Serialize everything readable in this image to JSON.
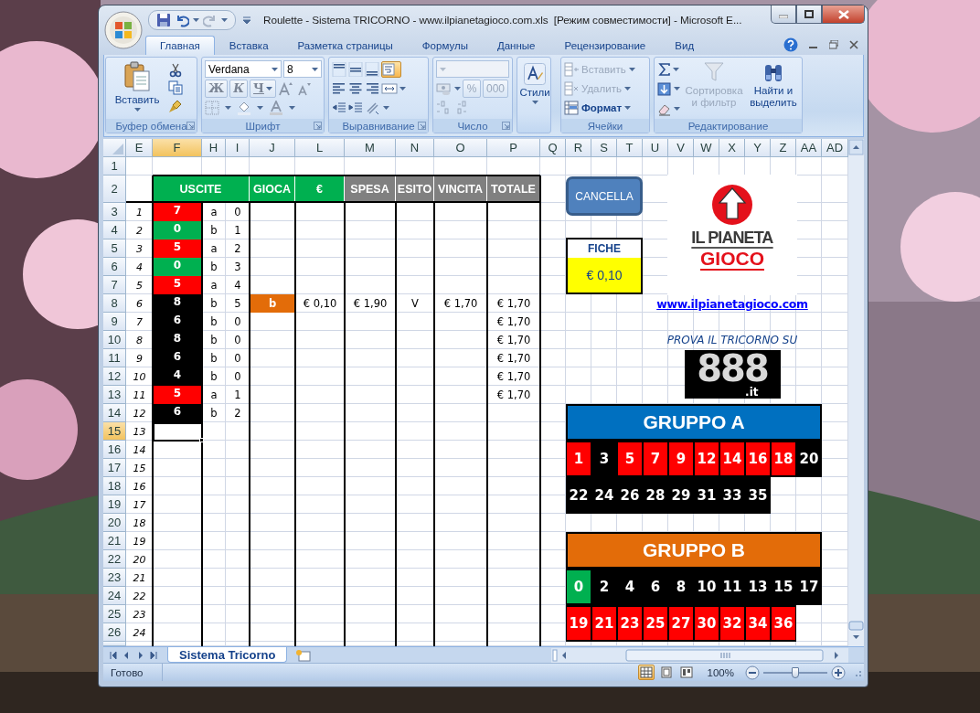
{
  "window": {
    "title": "Roulette - Sistema TRICORNO - www.ilpianetagioco.com.xls  [Режим совместимости] - Microsoft E..."
  },
  "ribbon_tabs": [
    {
      "label": "Главная",
      "selected": true
    },
    {
      "label": "Вставка",
      "selected": false
    },
    {
      "label": "Разметка страницы",
      "selected": false
    },
    {
      "label": "Формулы",
      "selected": false
    },
    {
      "label": "Данные",
      "selected": false
    },
    {
      "label": "Рецензирование",
      "selected": false
    },
    {
      "label": "Вид",
      "selected": false
    }
  ],
  "clipboard": {
    "label": "Буфер обмена",
    "paste": "Вставить"
  },
  "font": {
    "label": "Шрифт",
    "name": "Verdana",
    "size": "8",
    "styles": [
      "Ж",
      "К",
      "Ч"
    ]
  },
  "alignment": {
    "label": "Выравнивание",
    "wrap_text": {
      "on": true
    }
  },
  "number": {
    "label": "Число",
    "buttons": [
      "%",
      "000"
    ]
  },
  "styles": {
    "label": "Стили"
  },
  "cells": {
    "label": "Ячейки",
    "items": [
      {
        "label": "Вставить",
        "disabled": true
      },
      {
        "label": "Удалить",
        "disabled": true
      },
      {
        "label": "Формат",
        "disabled": false
      }
    ]
  },
  "editing": {
    "label": "Редактирование",
    "items": [
      {
        "label": "Сортировка и фильтр",
        "disabled": true
      },
      {
        "label": "Найти и выделить",
        "disabled": false
      }
    ]
  },
  "columns": [
    {
      "label": "E",
      "selected": false
    },
    {
      "label": "F",
      "selected": true
    },
    {
      "label": "H",
      "selected": false
    },
    {
      "label": "I",
      "selected": false
    },
    {
      "label": "J",
      "selected": false
    },
    {
      "label": "L",
      "selected": false
    },
    {
      "label": "M",
      "selected": false
    },
    {
      "label": "N",
      "selected": false
    },
    {
      "label": "O",
      "selected": false
    },
    {
      "label": "P",
      "selected": false
    },
    {
      "label": "Q",
      "selected": false
    },
    {
      "label": "R",
      "selected": false
    },
    {
      "label": "S",
      "selected": false
    },
    {
      "label": "T",
      "selected": false
    },
    {
      "label": "U",
      "selected": false
    },
    {
      "label": "V",
      "selected": false
    },
    {
      "label": "W",
      "selected": false
    },
    {
      "label": "X",
      "selected": false
    },
    {
      "label": "Y",
      "selected": false
    },
    {
      "label": "Z",
      "selected": false
    },
    {
      "label": "AA",
      "selected": false
    },
    {
      "label": "AD",
      "selected": false
    }
  ],
  "row_numbers": [
    {
      "label": "1",
      "selected": false
    },
    {
      "label": "2",
      "selected": false
    },
    {
      "label": "3",
      "selected": false
    },
    {
      "label": "4",
      "selected": false
    },
    {
      "label": "5",
      "selected": false
    },
    {
      "label": "6",
      "selected": false
    },
    {
      "label": "7",
      "selected": false
    },
    {
      "label": "8",
      "selected": false
    },
    {
      "label": "9",
      "selected": false
    },
    {
      "label": "10",
      "selected": false
    },
    {
      "label": "11",
      "selected": false
    },
    {
      "label": "12",
      "selected": false
    },
    {
      "label": "13",
      "selected": false
    },
    {
      "label": "14",
      "selected": false
    },
    {
      "label": "15",
      "selected": true
    },
    {
      "label": "16",
      "selected": false
    },
    {
      "label": "17",
      "selected": false
    },
    {
      "label": "18",
      "selected": false
    },
    {
      "label": "19",
      "selected": false
    },
    {
      "label": "20",
      "selected": false
    },
    {
      "label": "21",
      "selected": false
    },
    {
      "label": "22",
      "selected": false
    },
    {
      "label": "23",
      "selected": false
    },
    {
      "label": "24",
      "selected": false
    },
    {
      "label": "25",
      "selected": false
    },
    {
      "label": "26",
      "selected": false
    }
  ],
  "headers": [
    {
      "label": "USCITE",
      "color": "#00b050"
    },
    {
      "label": "GIOCA",
      "color": "#00b050"
    },
    {
      "label": "€",
      "color": "#00b050"
    },
    {
      "label": "SPESA",
      "color": "#808080"
    },
    {
      "label": "ESITO",
      "color": "#808080"
    },
    {
      "label": "VINCITA",
      "color": "#808080"
    },
    {
      "label": "TOTALE",
      "color": "#808080"
    }
  ],
  "rows": [
    {
      "index": "1",
      "number": "7",
      "color": "#ff0000",
      "letter": "a",
      "count": "0",
      "selected": false
    },
    {
      "index": "2",
      "number": "0",
      "color": "#00b050",
      "letter": "b",
      "count": "1",
      "selected": false
    },
    {
      "index": "3",
      "number": "5",
      "color": "#ff0000",
      "letter": "a",
      "count": "2",
      "selected": false
    },
    {
      "index": "4",
      "number": "0",
      "color": "#00b050",
      "letter": "b",
      "count": "3",
      "selected": false
    },
    {
      "index": "5",
      "number": "5",
      "color": "#ff0000",
      "letter": "a",
      "count": "4",
      "selected": false
    },
    {
      "index": "6",
      "number": "8",
      "color": "#000000",
      "letter": "b",
      "count": "5",
      "gioca": "b",
      "bet": "€ 0,10",
      "spesa": "€ 1,90",
      "esito": "V",
      "vincita": "€ 1,70",
      "totale": "€ 1,70",
      "selected": false
    },
    {
      "index": "7",
      "number": "6",
      "color": "#000000",
      "letter": "b",
      "count": "0",
      "totale": "€ 1,70",
      "selected": false
    },
    {
      "index": "8",
      "number": "8",
      "color": "#000000",
      "letter": "b",
      "count": "0",
      "totale": "€ 1,70",
      "selected": false
    },
    {
      "index": "9",
      "number": "6",
      "color": "#000000",
      "letter": "b",
      "count": "0",
      "totale": "€ 1,70",
      "selected": false
    },
    {
      "index": "10",
      "number": "4",
      "color": "#000000",
      "letter": "b",
      "count": "0",
      "totale": "€ 1,70",
      "selected": false
    },
    {
      "index": "11",
      "number": "5",
      "color": "#ff0000",
      "letter": "a",
      "count": "1",
      "totale": "€ 1,70",
      "selected": false
    },
    {
      "index": "12",
      "number": "6",
      "color": "#000000",
      "letter": "b",
      "count": "2",
      "selected": false
    },
    {
      "index": "13",
      "selected": true
    },
    {
      "index": "14",
      "selected": false
    },
    {
      "index": "15",
      "selected": false
    },
    {
      "index": "16",
      "selected": false
    },
    {
      "index": "17",
      "selected": false
    },
    {
      "index": "18",
      "selected": false
    },
    {
      "index": "19",
      "selected": false
    },
    {
      "index": "20",
      "selected": false
    },
    {
      "index": "21",
      "selected": false
    },
    {
      "index": "22",
      "selected": false
    },
    {
      "index": "23",
      "selected": false
    },
    {
      "index": "24",
      "selected": false
    }
  ],
  "cancel_button": "CANCELLA",
  "fiche": {
    "label": "FICHE",
    "value": "€ 0,10"
  },
  "logo": {
    "lines": [
      "IL PIANETA",
      "GIOCO"
    ]
  },
  "link": "www.ilpianetagioco.com",
  "promo": {
    "text": "PROVA IL TRICORNO SU",
    "logo": "888",
    "suffix": ".it"
  },
  "groups": [
    {
      "title": "GRUPPO A",
      "color": "#0070c0",
      "rows": [
        {
          "cells": [
            {
              "label": "1",
              "color": "#ff0000"
            },
            {
              "label": "3",
              "color": "#000000"
            },
            {
              "label": "5",
              "color": "#ff0000"
            },
            {
              "label": "7",
              "color": "#ff0000"
            },
            {
              "label": "9",
              "color": "#ff0000"
            },
            {
              "label": "12",
              "color": "#ff0000"
            },
            {
              "label": "14",
              "color": "#ff0000"
            },
            {
              "label": "16",
              "color": "#ff0000"
            },
            {
              "label": "18",
              "color": "#ff0000"
            },
            {
              "label": "20",
              "color": "#000000"
            }
          ]
        },
        {
          "cells": [
            {
              "label": "22",
              "color": "#000000"
            },
            {
              "label": "24",
              "color": "#000000"
            },
            {
              "label": "26",
              "color": "#000000"
            },
            {
              "label": "28",
              "color": "#000000"
            },
            {
              "label": "29",
              "color": "#000000"
            },
            {
              "label": "31",
              "color": "#000000"
            },
            {
              "label": "33",
              "color": "#000000"
            },
            {
              "label": "35",
              "color": "#000000"
            }
          ]
        }
      ]
    },
    {
      "title": "GRUPPO B",
      "color": "#e36c09",
      "rows": [
        {
          "cells": [
            {
              "label": "0",
              "color": "#00b050"
            },
            {
              "label": "2",
              "color": "#000000"
            },
            {
              "label": "4",
              "color": "#000000"
            },
            {
              "label": "6",
              "color": "#000000"
            },
            {
              "label": "8",
              "color": "#000000"
            },
            {
              "label": "10",
              "color": "#000000"
            },
            {
              "label": "11",
              "color": "#000000"
            },
            {
              "label": "13",
              "color": "#000000"
            },
            {
              "label": "15",
              "color": "#000000"
            },
            {
              "label": "17",
              "color": "#000000"
            }
          ]
        },
        {
          "cells": [
            {
              "label": "19",
              "color": "#ff0000"
            },
            {
              "label": "21",
              "color": "#ff0000"
            },
            {
              "label": "23",
              "color": "#ff0000"
            },
            {
              "label": "25",
              "color": "#ff0000"
            },
            {
              "label": "27",
              "color": "#ff0000"
            },
            {
              "label": "30",
              "color": "#ff0000"
            },
            {
              "label": "32",
              "color": "#ff0000"
            },
            {
              "label": "34",
              "color": "#ff0000"
            },
            {
              "label": "36",
              "color": "#ff0000"
            }
          ]
        }
      ]
    }
  ],
  "sheet_tabs": [
    {
      "label": "Sistema Tricorno",
      "selected": true
    }
  ],
  "status_bar": {
    "text": "Готово",
    "zoom": "100%",
    "view_buttons": [
      {
        "selected": true
      },
      {
        "selected": false
      },
      {
        "selected": false
      }
    ],
    "zoom_slider": {
      "level": 0.5
    }
  }
}
